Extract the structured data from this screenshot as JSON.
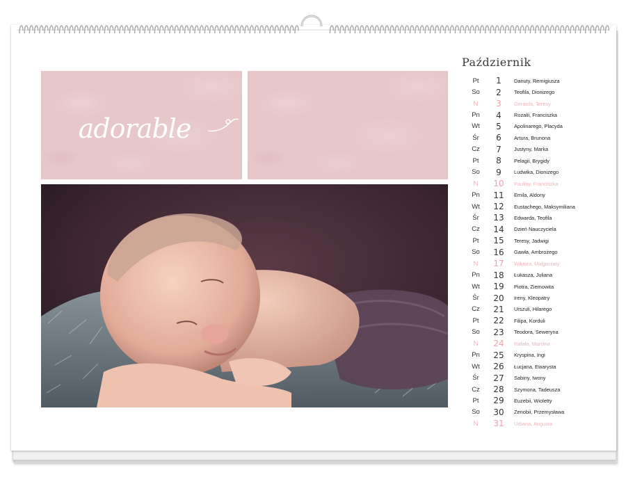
{
  "calendar": {
    "month": "Październik",
    "accent_color": "#f0a1ac",
    "tile_color": "#e7c7ca"
  },
  "collage": {
    "word_tile_text": "adorable",
    "photo_subject": "sleeping newborn on fur rug"
  },
  "days": [
    {
      "weekday": "Pt",
      "day": "1",
      "names": "Danuty, Remigiusza",
      "sunday": false
    },
    {
      "weekday": "So",
      "day": "2",
      "names": "Teofila, Dionizego",
      "sunday": false
    },
    {
      "weekday": "N",
      "day": "3",
      "names": "Gerarda, Teresy",
      "sunday": true
    },
    {
      "weekday": "Pn",
      "day": "4",
      "names": "Rozalii, Franciszka",
      "sunday": false
    },
    {
      "weekday": "Wt",
      "day": "5",
      "names": "Apolinarego, Placyda",
      "sunday": false
    },
    {
      "weekday": "Śr",
      "day": "6",
      "names": "Artura, Brunona",
      "sunday": false
    },
    {
      "weekday": "Cz",
      "day": "7",
      "names": "Justyny, Marka",
      "sunday": false
    },
    {
      "weekday": "Pt",
      "day": "8",
      "names": "Pelagii, Brygidy",
      "sunday": false
    },
    {
      "weekday": "So",
      "day": "9",
      "names": "Ludwika, Dionizego",
      "sunday": false
    },
    {
      "weekday": "N",
      "day": "10",
      "names": "Pauliny, Franciszka",
      "sunday": true
    },
    {
      "weekday": "Pn",
      "day": "11",
      "names": "Emila, Aldony",
      "sunday": false
    },
    {
      "weekday": "Wt",
      "day": "12",
      "names": "Eustachego, Maksymiliana",
      "sunday": false
    },
    {
      "weekday": "Śr",
      "day": "13",
      "names": "Edwarda, Teofila",
      "sunday": false
    },
    {
      "weekday": "Cz",
      "day": "14",
      "names": "Dzień Nauczyciela",
      "sunday": false
    },
    {
      "weekday": "Pt",
      "day": "15",
      "names": "Teresy, Jadwigi",
      "sunday": false
    },
    {
      "weekday": "So",
      "day": "16",
      "names": "Gawła, Ambrożego",
      "sunday": false
    },
    {
      "weekday": "N",
      "day": "17",
      "names": "Wiktora, Małgorzaty",
      "sunday": true
    },
    {
      "weekday": "Pn",
      "day": "18",
      "names": "Łukasza, Juliana",
      "sunday": false
    },
    {
      "weekday": "Wt",
      "day": "19",
      "names": "Piotra, Ziemowita",
      "sunday": false
    },
    {
      "weekday": "Śr",
      "day": "20",
      "names": "Ireny, Kleopatry",
      "sunday": false
    },
    {
      "weekday": "Cz",
      "day": "21",
      "names": "Urszuli, Hilarego",
      "sunday": false
    },
    {
      "weekday": "Pt",
      "day": "22",
      "names": "Filipa, Korduli",
      "sunday": false
    },
    {
      "weekday": "So",
      "day": "23",
      "names": "Teodora, Seweryna",
      "sunday": false
    },
    {
      "weekday": "N",
      "day": "24",
      "names": "Rafała, Marcina",
      "sunday": true
    },
    {
      "weekday": "Pn",
      "day": "25",
      "names": "Kryspina, Ingi",
      "sunday": false
    },
    {
      "weekday": "Wt",
      "day": "26",
      "names": "Łucjana, Ewarysta",
      "sunday": false
    },
    {
      "weekday": "Śr",
      "day": "27",
      "names": "Sabiny, Iwony",
      "sunday": false
    },
    {
      "weekday": "Cz",
      "day": "28",
      "names": "Szymona, Tadeusza",
      "sunday": false
    },
    {
      "weekday": "Pt",
      "day": "29",
      "names": "Euzebii, Wioletty",
      "sunday": false
    },
    {
      "weekday": "So",
      "day": "30",
      "names": "Zenobii, Przemysława",
      "sunday": false
    },
    {
      "weekday": "N",
      "day": "31",
      "names": "Urbana, Augusta",
      "sunday": true
    }
  ]
}
